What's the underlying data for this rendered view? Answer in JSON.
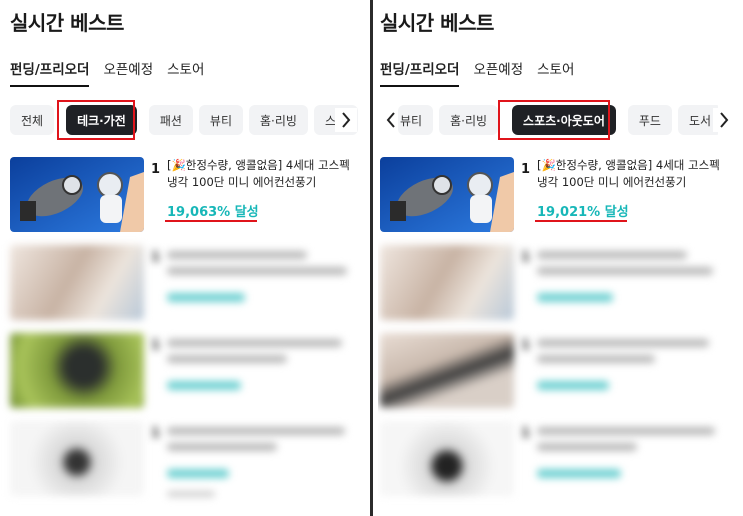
{
  "left": {
    "title": "실시간 베스트",
    "subtabs": [
      "펀딩/프리오더",
      "오픈예정",
      "스토어"
    ],
    "chips": [
      "전체",
      "테크·가전",
      "패션",
      "뷰티",
      "홈·리빙",
      "스포"
    ],
    "active_chip": "테크·가전",
    "item": {
      "rank": "1",
      "title_line1": "[🎉한정수량, 앵콜없음] 4세대 고스펙",
      "title_line2": "냉각 100단 미니 에어컨선풍기",
      "rate": "19,063% 달성"
    },
    "blurred_ranks": [
      "1",
      "1",
      "1"
    ]
  },
  "right": {
    "title": "실시간 베스트",
    "subtabs": [
      "펀딩/프리오더",
      "오픈예정",
      "스토어"
    ],
    "chips": [
      "뷰티",
      "홈·리빙",
      "스포츠·아웃도어",
      "푸드",
      "도서"
    ],
    "active_chip": "스포츠·아웃도어",
    "item": {
      "rank": "1",
      "title_line1": "[🎉한정수량, 앵콜없음] 4세대 고스펙",
      "title_line2": "냉각 100단 미니 에어컨선풍기",
      "rate": "19,021% 달성"
    },
    "blurred_ranks": [
      "1",
      "1",
      "1"
    ]
  },
  "icons": {
    "prev": "chevron-left-icon",
    "next": "chevron-right-icon"
  },
  "colors": {
    "accent_teal": "#17b7b8",
    "highlight_red": "#e0141b",
    "active_chip_bg": "#1f2125"
  }
}
